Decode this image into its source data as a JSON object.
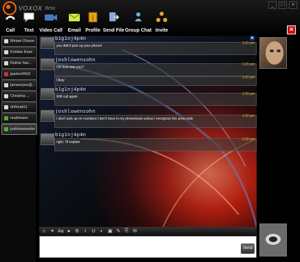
{
  "app": {
    "name": "VOXOX",
    "badge": "Beta"
  },
  "window_controls": [
    "_",
    "□",
    "×"
  ],
  "toolbar": [
    {
      "label": "Call",
      "icon": "phone-icon"
    },
    {
      "label": "Text",
      "icon": "chat-bubble-icon"
    },
    {
      "label": "Video Call",
      "icon": "video-camera-icon"
    },
    {
      "label": "Email",
      "icon": "envelope-icon"
    },
    {
      "label": "Profile",
      "icon": "profile-card-icon"
    },
    {
      "label": "Send File",
      "icon": "send-file-icon"
    },
    {
      "label": "Group Chat",
      "icon": "group-chat-icon"
    },
    {
      "label": "Invite",
      "icon": "invite-icon"
    }
  ],
  "close_tab_label": "×",
  "contacts": [
    {
      "name": "Miriam Olsson",
      "color": "#d9d9d9"
    },
    {
      "name": "Kristian Kose",
      "color": "#d9d9d9"
    },
    {
      "name": "Ruthie Sav...",
      "color": "#d9d9d9"
    },
    {
      "name": "jparker9410",
      "color": "#cc3333"
    },
    {
      "name": "jamesvyee@...",
      "color": "#d9d9d9"
    },
    {
      "name": "Christina ...",
      "color": "#d9d9d9"
    },
    {
      "name": "ohiheati11",
      "color": "#d9d9d9"
    },
    {
      "name": "noahlowsv",
      "color": "#55aa33"
    },
    {
      "name": "joshlowensohn",
      "color": "#55aa33",
      "active": true
    }
  ],
  "messages": [
    {
      "sender": "b1g1nj4p4n",
      "lines": [
        {
          "text": "you didn't pick up your phone!",
          "time": "1:21 pm"
        }
      ]
    },
    {
      "sender": "joshlowensohn",
      "lines": [
        {
          "text": "OH that was you?",
          "time": "1:21 pm"
        },
        {
          "text": "Okay",
          "time": "1:21 pm"
        }
      ]
    },
    {
      "sender": "b1g1nj4p4n",
      "lines": [
        {
          "text": "Will call again",
          "time": "1:21 pm"
        }
      ]
    },
    {
      "sender": "joshlowensohn",
      "lines": [
        {
          "text": "I don't pick up on numbers I don't have in my phonebook unless I recognize the area code",
          "time": "1:22 pm"
        }
      ]
    },
    {
      "sender": "b1g1nj4p4n",
      "lines": [
        {
          "text": "right. I'll explain",
          "time": "1:22 pm"
        }
      ]
    }
  ],
  "composer": {
    "tools": [
      {
        "icon": "emoticon-icon",
        "glyph": "☺"
      },
      {
        "icon": "sparkle-icon",
        "glyph": "✶"
      },
      {
        "icon": "font-icon",
        "glyph": "Aa"
      },
      {
        "icon": "color-icon",
        "glyph": "●"
      },
      {
        "icon": "bold-icon",
        "glyph": "B"
      },
      {
        "icon": "italic-icon",
        "glyph": "I"
      },
      {
        "icon": "underline-icon",
        "glyph": "U"
      },
      {
        "icon": "palette-icon",
        "glyph": "◐"
      },
      {
        "icon": "image-icon",
        "glyph": "▣"
      },
      {
        "icon": "note-icon",
        "glyph": "✎"
      },
      {
        "icon": "attach-icon",
        "glyph": "⎘"
      },
      {
        "icon": "mail-icon",
        "glyph": "✉"
      }
    ],
    "placeholder": "",
    "send_label": "Send"
  }
}
